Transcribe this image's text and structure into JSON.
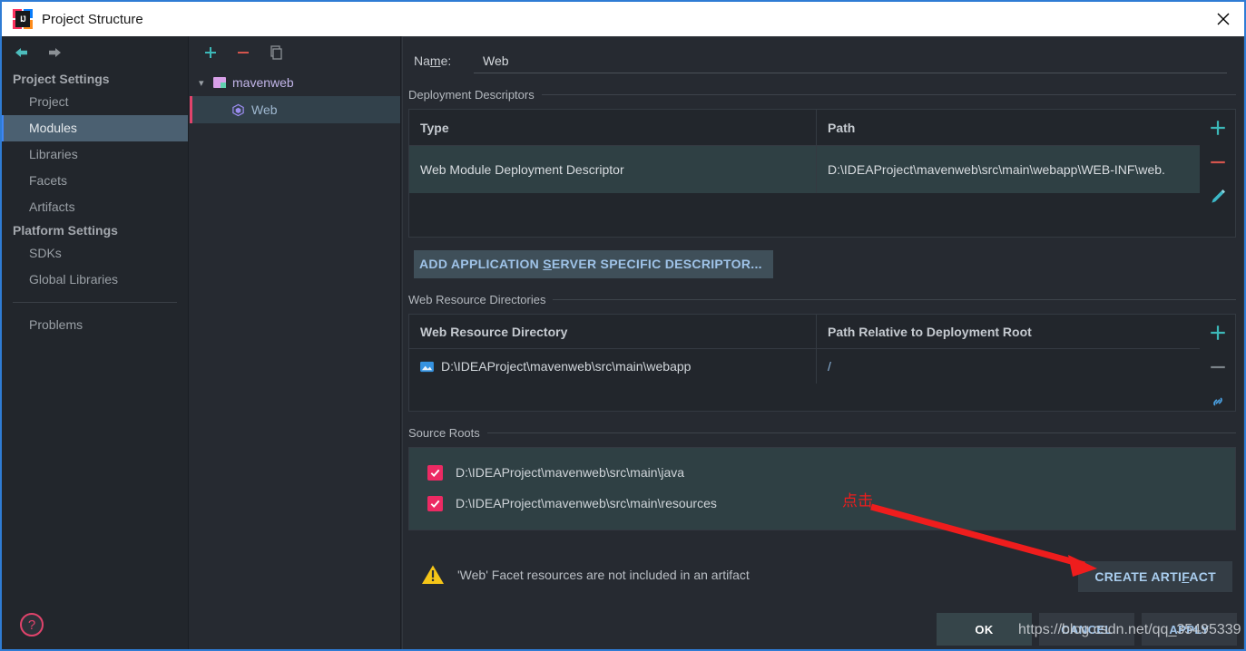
{
  "window": {
    "title": "Project Structure",
    "app_icon": "intellij-idea-icon",
    "close_icon": "close-icon",
    "accent_border": "#2f7cd4"
  },
  "sidebar": {
    "back_icon": "back-arrow-icon",
    "forward_icon": "forward-arrow-icon",
    "help_icon": "help-icon",
    "groups": [
      {
        "heading": "Project Settings",
        "items": [
          {
            "label": "Project",
            "selected": false
          },
          {
            "label": "Modules",
            "selected": true
          },
          {
            "label": "Libraries",
            "selected": false
          },
          {
            "label": "Facets",
            "selected": false
          },
          {
            "label": "Artifacts",
            "selected": false
          }
        ]
      },
      {
        "heading": "Platform Settings",
        "items": [
          {
            "label": "SDKs",
            "selected": false
          },
          {
            "label": "Global Libraries",
            "selected": false
          }
        ]
      }
    ],
    "problems_label": "Problems"
  },
  "tree": {
    "toolbar": {
      "add_icon": "plus-icon",
      "remove_icon": "minus-icon",
      "copy_icon": "copy-icon"
    },
    "nodes": [
      {
        "label": "mavenweb",
        "icon": "folder-module-icon",
        "expanded": true,
        "selected": false
      },
      {
        "label": "Web",
        "icon": "web-facet-cube-icon",
        "selected": true
      }
    ],
    "expand_chevron": "chevron-down-icon"
  },
  "main": {
    "name_label": "Name:",
    "name_label_prefix": "Na",
    "name_label_mnemonic": "m",
    "name_label_suffix": "e:",
    "name_value": "Web",
    "deployment_descriptors": {
      "title": "Deployment Descriptors",
      "columns": [
        "Type",
        "Path"
      ],
      "rows": [
        {
          "type": "Web Module Deployment Descriptor",
          "path": "D:\\IDEAProject\\mavenweb\\src\\main\\webapp\\WEB-INF\\web.",
          "selected": true
        }
      ],
      "tools": {
        "add_icon": "plus-icon",
        "remove_icon": "minus-icon",
        "edit_icon": "pencil-edit-icon"
      }
    },
    "add_descriptor_button": {
      "prefix": "ADD APPLICATION ",
      "mnemonic": "S",
      "suffix": "ERVER SPECIFIC DESCRIPTOR..."
    },
    "web_resource_directories": {
      "title": "Web Resource Directories",
      "columns": [
        "Web Resource Directory",
        "Path Relative to Deployment Root"
      ],
      "rows": [
        {
          "directory": "D:\\IDEAProject\\mavenweb\\src\\main\\webapp",
          "relative_path": "/",
          "icon": "image-folder-icon"
        }
      ],
      "tools": {
        "add_icon": "plus-icon",
        "remove_icon": "minus-icon",
        "link_icon": "link-icon"
      }
    },
    "source_roots": {
      "title": "Source Roots",
      "items": [
        {
          "path": "D:\\IDEAProject\\mavenweb\\src\\main\\java",
          "checked": true
        },
        {
          "path": "D:\\IDEAProject\\mavenweb\\src\\main\\resources",
          "checked": true
        }
      ]
    },
    "warning": {
      "icon": "warning-triangle-icon",
      "text": "'Web' Facet resources are not included in an artifact"
    },
    "create_artifact_button": {
      "prefix": "CREATE ARTI",
      "mnemonic": "F",
      "suffix": "ACT"
    }
  },
  "footer": {
    "buttons": [
      {
        "label": "OK",
        "style": "primary"
      },
      {
        "label": "CANCEL",
        "style": "default"
      },
      {
        "label": "APPLY",
        "style": "default"
      }
    ]
  },
  "annotations": {
    "callout_text": "点击",
    "arrow_color": "#ef1d1d",
    "watermark": "https://blog.csdn.net/qq_35495339"
  }
}
